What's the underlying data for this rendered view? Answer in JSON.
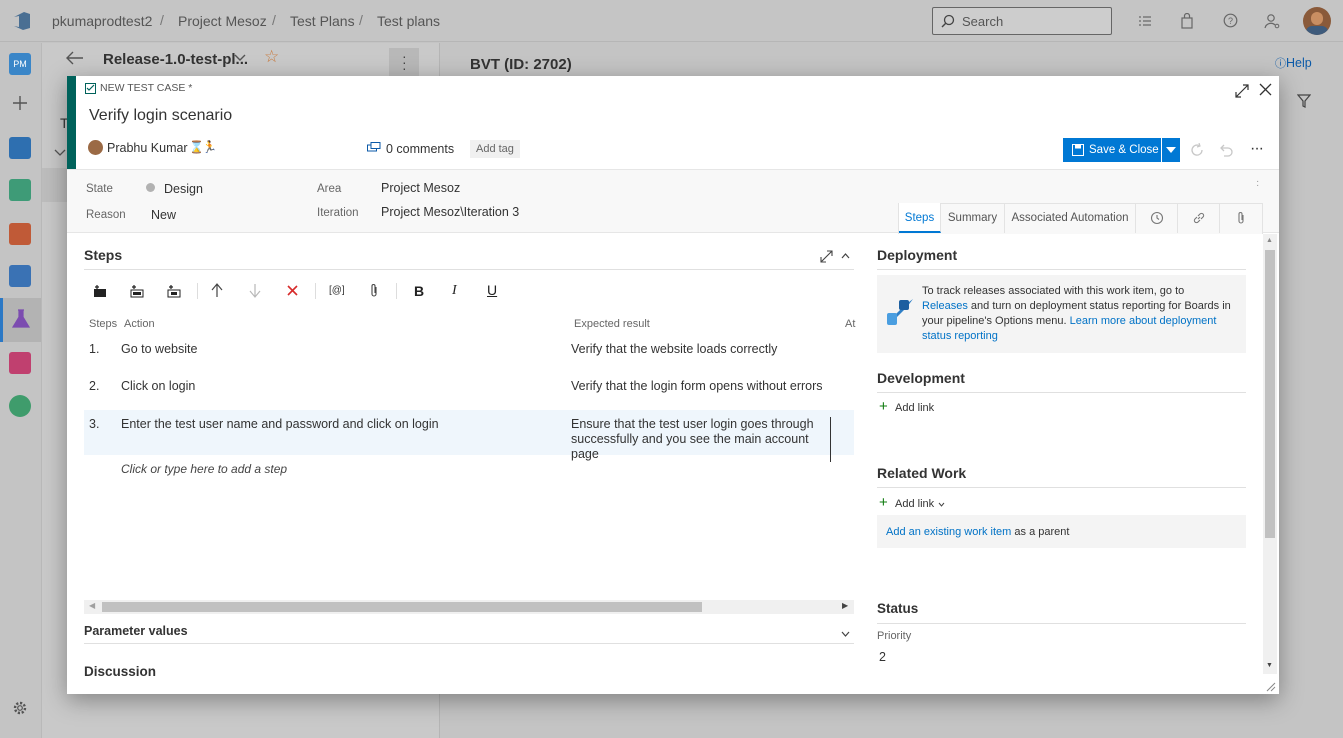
{
  "topbar": {
    "org": "pkumaprodtest2",
    "project": "Project Mesoz",
    "section": "Test Plans",
    "page": "Test plans",
    "separator": "/",
    "search_placeholder": "Search"
  },
  "leftnav": {
    "project_initials": "PM"
  },
  "background": {
    "plan_title": "Release-1.0-test-pl...",
    "suite_title": "BVT (ID: 2702)",
    "help_label": "Help",
    "partial_letter": "T"
  },
  "dialog": {
    "type_label": "NEW TEST CASE *",
    "title": "Verify login scenario",
    "assignee": "Prabhu Kumar",
    "comments": "0 comments",
    "add_tag": "Add tag",
    "save_close": "Save & Close",
    "fields": {
      "state_label": "State",
      "state_value": "Design",
      "reason_label": "Reason",
      "reason_value": "New",
      "area_label": "Area",
      "area_value": "Project Mesoz",
      "iteration_label": "Iteration",
      "iteration_value": "Project Mesoz\\Iteration 3"
    },
    "tabs": [
      "Steps",
      "Summary",
      "Associated Automation"
    ],
    "steps": {
      "title": "Steps",
      "col_steps": "Steps",
      "col_action": "Action",
      "col_expected": "Expected result",
      "col_at": "At",
      "rows": [
        {
          "num": "1.",
          "action": "Go to website",
          "expected": "Verify that the website loads correctly"
        },
        {
          "num": "2.",
          "action": "Click on login",
          "expected": "Verify that the login form opens without errors"
        },
        {
          "num": "3.",
          "action": "Enter the test user name and password and click on login",
          "expected": "Ensure that the test user login goes through successfully and you see the main account page"
        }
      ],
      "add_step": "Click or type here to add a step",
      "toolbar_bold": "B",
      "toolbar_italic": "I",
      "toolbar_underline": "U",
      "toolbar_param": "[@]"
    },
    "parameter_values": "Parameter values",
    "discussion": "Discussion",
    "deployment": {
      "title": "Deployment",
      "text_before": "To track releases associated with this work item, go to",
      "releases_link": "Releases",
      "text_after": "and turn on deployment status reporting for Boards in your pipeline's Options menu.",
      "learn_link": "Learn more about deployment status reporting"
    },
    "development": {
      "title": "Development",
      "add_link": "Add link"
    },
    "related_work": {
      "title": "Related Work",
      "add_link": "Add link",
      "existing_link": "Add an existing work item",
      "existing_suffix": "as a parent"
    },
    "status": {
      "title": "Status",
      "priority_label": "Priority",
      "priority_value": "2"
    }
  }
}
